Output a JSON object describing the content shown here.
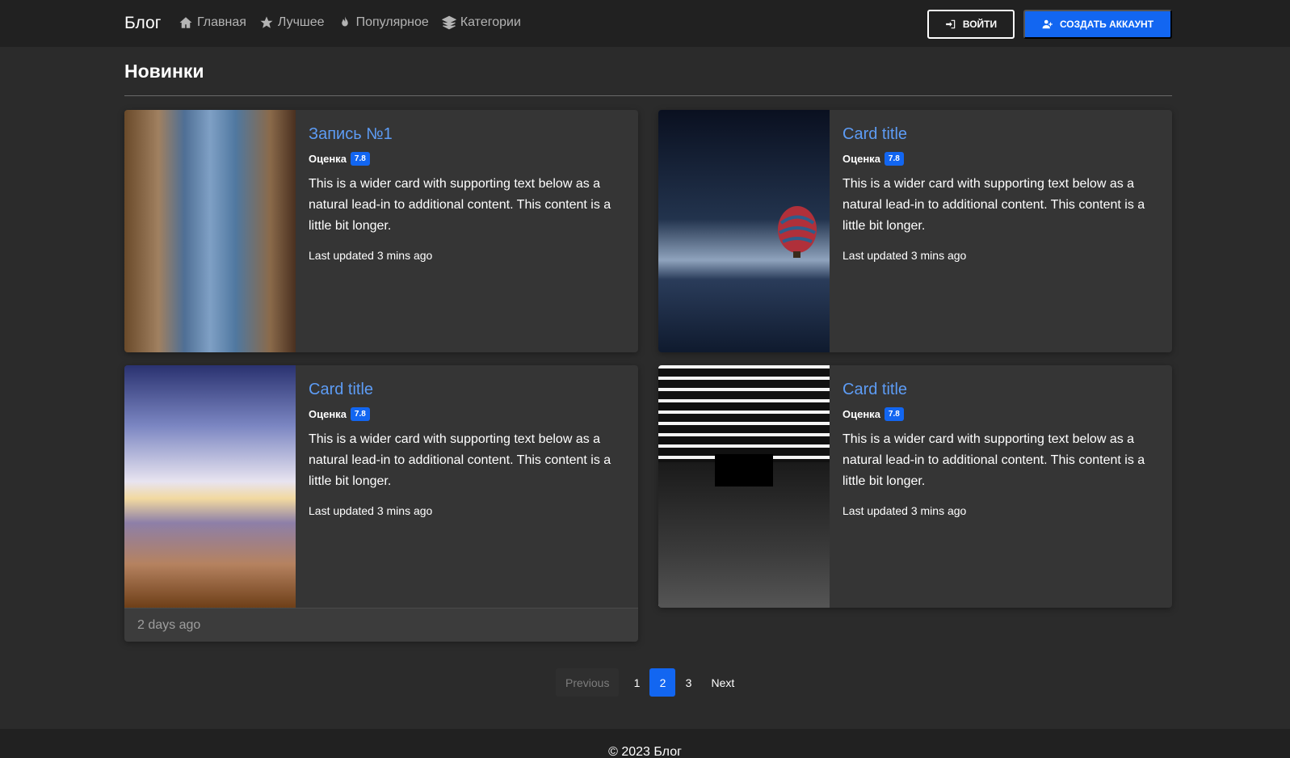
{
  "navbar": {
    "brand": "Блог",
    "links": [
      {
        "label": "Главная",
        "icon": "home-icon"
      },
      {
        "label": "Лучшее",
        "icon": "star-icon"
      },
      {
        "label": "Популярное",
        "icon": "fire-icon"
      },
      {
        "label": "Категории",
        "icon": "layers-icon"
      }
    ],
    "login_label": "ВОЙТИ",
    "signup_label": "СОЗДАТЬ АККАУНТ"
  },
  "page": {
    "heading": "Новинки"
  },
  "cards": [
    {
      "title": "Запись №1",
      "rating_label": "Оценка",
      "rating": "7.8",
      "text": "This is a wider card with supporting text below as a natural lead-in to additional content. This content is a little bit longer.",
      "updated": "Last updated 3 mins ago",
      "image": "jeans-boots-photo"
    },
    {
      "title": "Card title",
      "rating_label": "Оценка",
      "rating": "7.8",
      "text": "This is a wider card with supporting text below as a natural lead-in to additional content. This content is a little bit longer.",
      "updated": "Last updated 3 mins ago",
      "image": "hot-air-balloon-photo"
    },
    {
      "title": "Card title",
      "rating_label": "Оценка",
      "rating": "7.8",
      "text": "This is a wider card with supporting text below as a natural lead-in to additional content. This content is a little bit longer.",
      "updated": "Last updated 3 mins ago",
      "image": "beach-sunset-photo",
      "footer": "2 days ago"
    },
    {
      "title": "Card title",
      "rating_label": "Оценка",
      "rating": "7.8",
      "text": "This is a wider card with supporting text below as a natural lead-in to additional content. This content is a little bit longer.",
      "updated": "Last updated 3 mins ago",
      "image": "tunnel-bw-photo"
    }
  ],
  "pagination": {
    "previous": "Previous",
    "pages": [
      "1",
      "2",
      "3"
    ],
    "active": "2",
    "next": "Next"
  },
  "footer": {
    "text": "© 2023 Блог"
  },
  "colors": {
    "background": "#2b2b2b",
    "navbar": "#212121",
    "card": "#353535",
    "accent": "#1266f1",
    "title_link": "#5d9cf5"
  }
}
